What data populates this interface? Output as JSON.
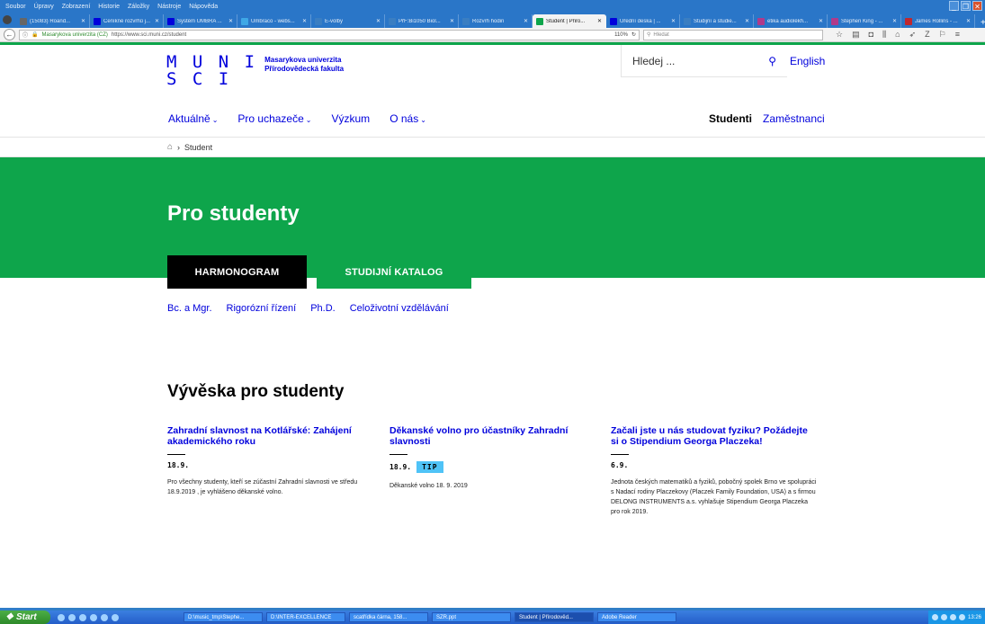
{
  "browser": {
    "menu": [
      "Soubor",
      "Úpravy",
      "Zobrazení",
      "Historie",
      "Záložky",
      "Nástroje",
      "Nápověda"
    ],
    "tabs": [
      {
        "label": "(15083) Roand...",
        "color": "#666",
        "active": false
      },
      {
        "label": "Ceníkné rozvrhů j...",
        "color": "#0000dc",
        "active": false
      },
      {
        "label": "Systém UMBRA ...",
        "color": "#0000dc",
        "active": false
      },
      {
        "label": "Umbraco - webs...",
        "color": "#3ea7e6",
        "active": false
      },
      {
        "label": "E-volby",
        "color": "#3a7ec2",
        "active": false
      },
      {
        "label": "PřF:Bi1050 Biol...",
        "color": "#3a7ec2",
        "active": false
      },
      {
        "label": "Rozvrh hodin",
        "color": "#3a7ec2",
        "active": false
      },
      {
        "label": "Student | Přiro...",
        "color": "#0ea54b",
        "active": true
      },
      {
        "label": "Úřední deska | ...",
        "color": "#0000dc",
        "active": false
      },
      {
        "label": "Studijní a studie...",
        "color": "#3a7ec2",
        "active": false
      },
      {
        "label": "etika audiolékh...",
        "color": "#b03a8a",
        "active": false
      },
      {
        "label": "Stephen King - ...",
        "color": "#b03a8a",
        "active": false
      },
      {
        "label": "James Rollins - ...",
        "color": "#c0282e",
        "active": false
      }
    ],
    "site_identity": "Masarykova univerzita (CZ)",
    "url": "https://www.sci.muni.cz/student",
    "zoom": "110%",
    "search_placeholder": "Hledat"
  },
  "header": {
    "logo_line1": "M U N I",
    "logo_line2": "S C I",
    "faculty": "Masarykova univerzita Přírodovědecká fakulta",
    "search_placeholder": "Hledej ...",
    "lang": "English",
    "nav": [
      {
        "label": "Aktuálně",
        "has_dropdown": true
      },
      {
        "label": "Pro uchazeče",
        "has_dropdown": true
      },
      {
        "label": "Výzkum",
        "has_dropdown": false
      },
      {
        "label": "O nás",
        "has_dropdown": true
      }
    ],
    "audience_students": "Studenti",
    "audience_staff": "Zaměstnanci"
  },
  "breadcrumb": {
    "current": "Student"
  },
  "hero": {
    "title": "Pro studenty"
  },
  "buttons": {
    "harmonogram": "HARMONOGRAM",
    "katalog": "STUDIJNÍ KATALOG"
  },
  "programs": [
    "Bc. a Mgr.",
    "Rigorózní řízení",
    "Ph.D.",
    "Celoživotní vzdělávání"
  ],
  "board": {
    "title": "Vývěska pro studenty",
    "items": [
      {
        "title": "Zahradní slavnost na Kotlářské: Zahájení akademického roku",
        "date": "18.9.",
        "badge": "",
        "text": "Pro všechny studenty, kteří se zúčastní Zahradní slavnosti ve středu 18.9.2019 , je vyhlášeno děkanské volno."
      },
      {
        "title": "Děkanské volno pro účastníky Zahradní slavnosti",
        "date": "18.9.",
        "badge": "TIP",
        "text": "Děkanské volno 18. 9. 2019"
      },
      {
        "title": "Začali jste u nás studovat fyziku? Požádejte si o Stipendium Georga Placzeka!",
        "date": "6.9.",
        "badge": "",
        "text": "Jednota českých matematiků a fyziků, pobočný spolek Brno ve spolupráci s Nadací rodiny Placzekovy (Placzek Family Foundation, USA) a s firmou DELONG INSTRUMENTS a.s. vyhlašuje Stipendium Georga Placzeka pro rok 2019."
      }
    ]
  },
  "taskbar": {
    "start": "Start",
    "tasks": [
      {
        "label": "D:\\music_tmp\\Stephe...",
        "active": false
      },
      {
        "label": "D:\\INTER-EXCELLENCE",
        "active": false
      },
      {
        "label": "scatřídka čárna, 158...",
        "active": false
      },
      {
        "label": "SZR.ppt",
        "active": false
      },
      {
        "label": "Student | Přírodověd...",
        "active": true
      },
      {
        "label": "Adobe Reader",
        "active": false
      }
    ],
    "clock": "13:26"
  }
}
